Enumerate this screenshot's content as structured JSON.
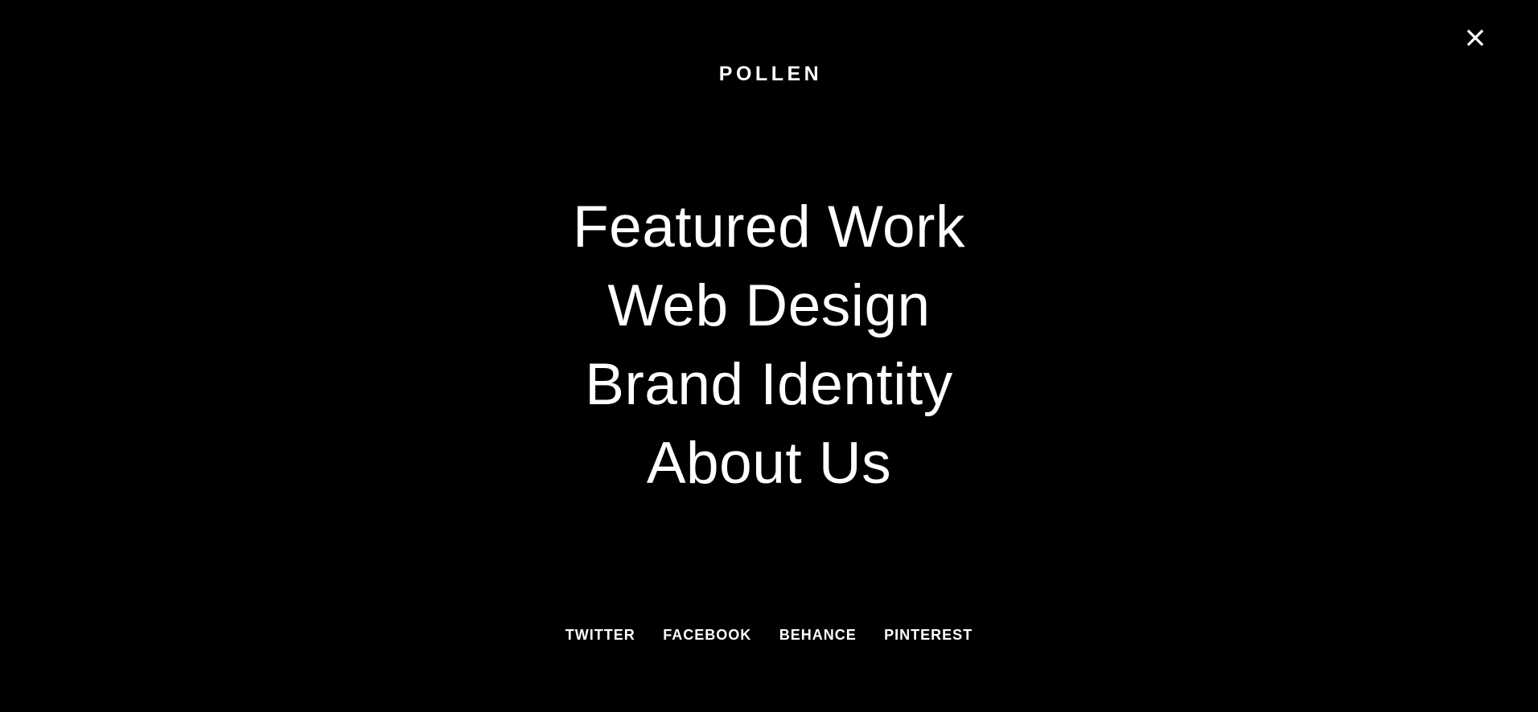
{
  "header": {
    "logo_text": "POLLEN",
    "close_icon": "close-icon"
  },
  "menu": {
    "items": [
      {
        "label": "Featured Work"
      },
      {
        "label": "Web Design"
      },
      {
        "label": "Brand Identity"
      },
      {
        "label": "About Us"
      }
    ]
  },
  "social": {
    "links": [
      {
        "label": "TWITTER"
      },
      {
        "label": "FACEBOOK"
      },
      {
        "label": "BEHANCE"
      },
      {
        "label": "PINTEREST"
      }
    ]
  },
  "colors": {
    "background": "#000000",
    "text": "#ffffff"
  }
}
